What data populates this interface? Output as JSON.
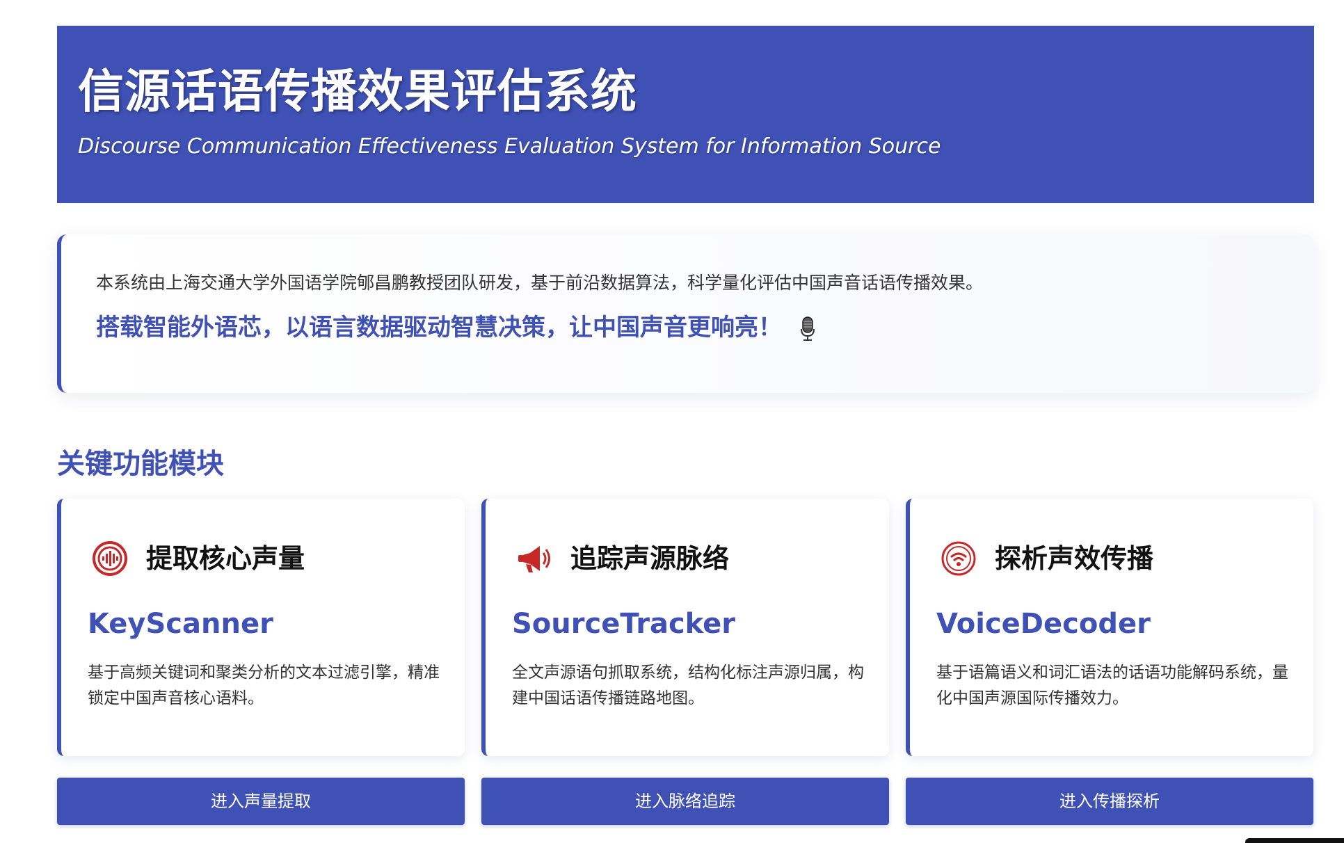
{
  "header": {
    "title": "信源话语传播效果评估系统",
    "subtitle": "Discourse Communication Effectiveness Evaluation System for Information Source"
  },
  "intro": {
    "description": "本系统由上海交通大学外国语学院郇昌鹏教授团队研发，基于前沿数据算法，科学量化评估中国声音话语传播效果。",
    "slogan": "搭载智能外语芯，以语言数据驱动智慧决策，让中国声音更响亮！",
    "slogan_icon": "microphone-icon"
  },
  "modules": {
    "section_title": "关键功能模块",
    "items": [
      {
        "title": "提取核心声量",
        "name": "KeyScanner",
        "description": "基于高频关键词和聚类分析的文本过滤引擎，精准锁定中国声音核心语料。",
        "icon": "sound-wave-icon",
        "button_label": "进入声量提取"
      },
      {
        "title": "追踪声源脉络",
        "name": "SourceTracker",
        "description": "全文声源语句抓取系统，结构化标注声源归属，构建中国话语传播链路地图。",
        "icon": "megaphone-icon",
        "button_label": "进入脉络追踪"
      },
      {
        "title": "探析声效传播",
        "name": "VoiceDecoder",
        "description": "基于语篇语义和词汇语法的话语功能解码系统，量化中国声源国际传播效力。",
        "icon": "broadcast-icon",
        "button_label": "进入传播探析"
      }
    ]
  },
  "colors": {
    "primary": "#3f51b5",
    "icon_red": "#c62828",
    "text_dark": "#111111",
    "text_body": "#333333"
  }
}
